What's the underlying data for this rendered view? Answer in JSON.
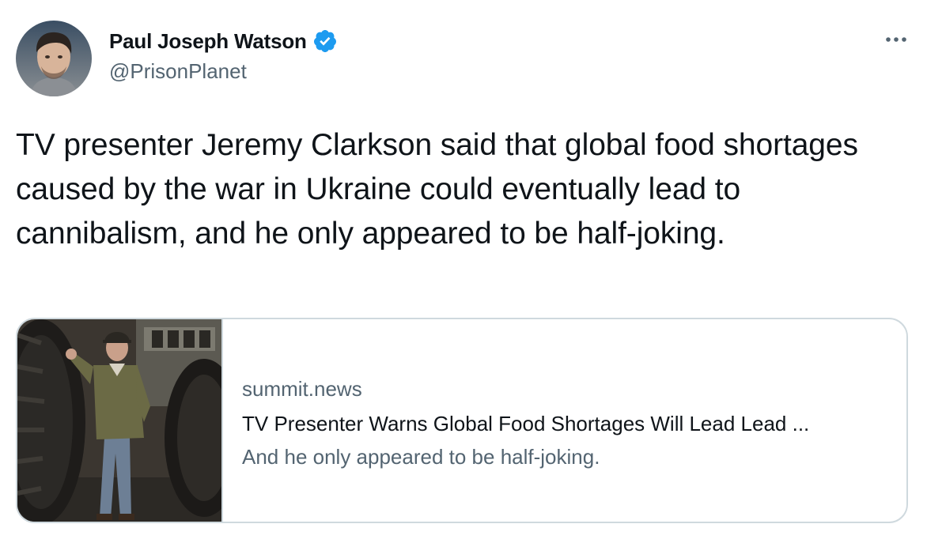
{
  "author": {
    "display_name": "Paul Joseph Watson",
    "handle": "@PrisonPlanet",
    "verified": true,
    "avatar_icon": "profile-photo"
  },
  "tweet": {
    "text": "TV presenter Jeremy Clarkson said that global food shortages caused by the war in Ukraine could eventually lead to cannibalism, and he only appeared to be half-joking."
  },
  "link_card": {
    "domain": "summit.news",
    "title": "TV Presenter Warns Global Food Shortages Will Lead Lead ...",
    "description": "And he only appeared to be half-joking.",
    "image_icon": "article-thumbnail-photo"
  },
  "icons": {
    "more": "more-options-icon",
    "verified": "verified-badge-icon"
  },
  "colors": {
    "text_primary": "#0f1419",
    "text_secondary": "#536471",
    "verified_blue": "#1d9bf0",
    "card_border": "#cfd9de"
  }
}
